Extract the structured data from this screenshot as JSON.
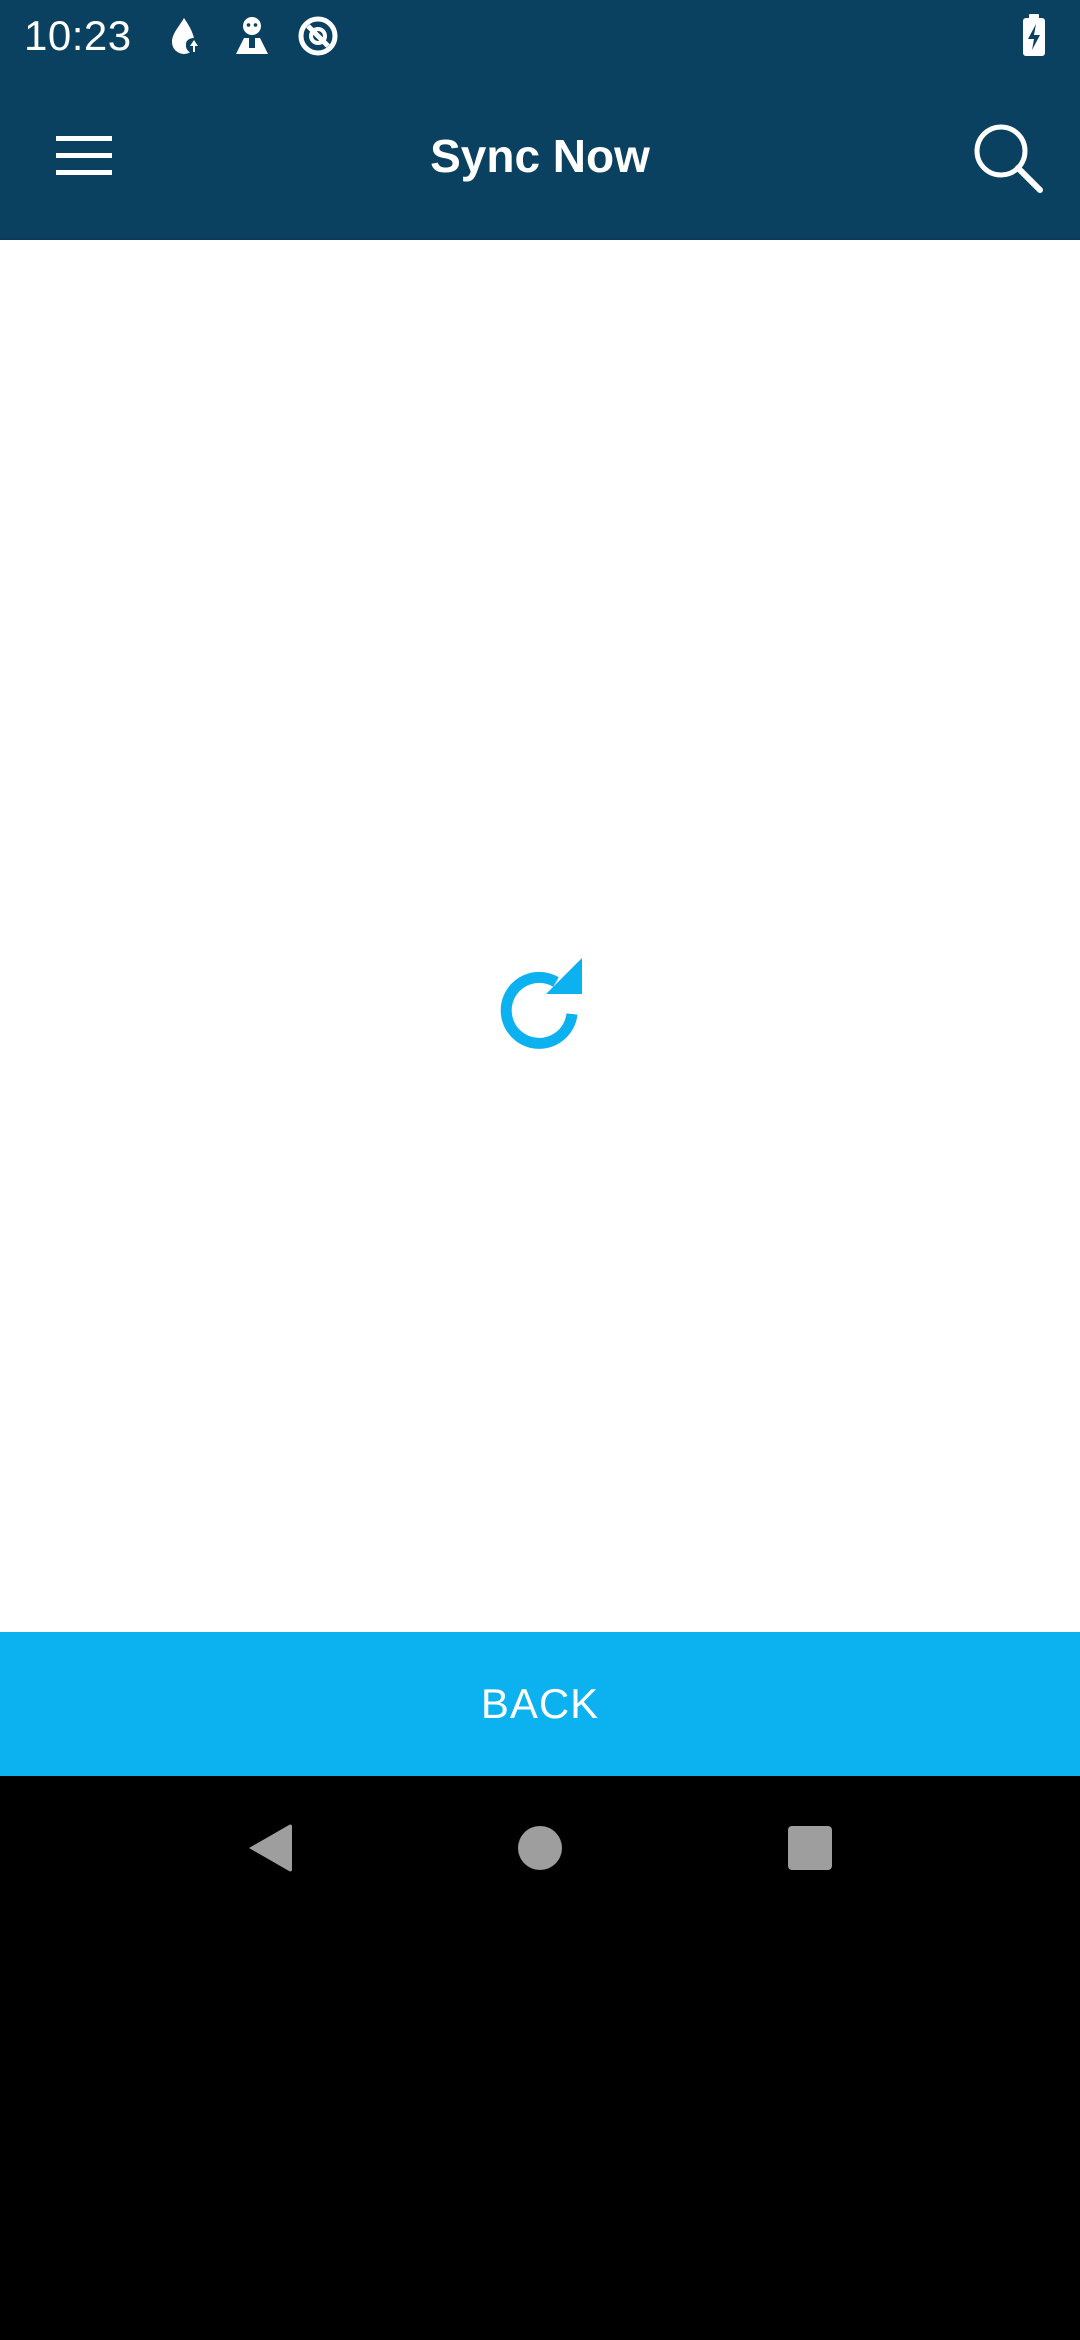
{
  "status_bar": {
    "time": "10:23",
    "icons": [
      "drop-notification-icon",
      "avatar-notification-icon",
      "no-disturb-icon"
    ],
    "battery_icon": "battery-charging-icon"
  },
  "app_bar": {
    "title": "Sync Now",
    "menu_icon": "hamburger-menu-icon",
    "search_icon": "search-icon",
    "background_color": "#0b4160"
  },
  "content": {
    "sync_icon": "refresh-icon",
    "accent_color": "#0cb1f0"
  },
  "footer": {
    "back_label": "BACK",
    "background_color": "#0cb1f0"
  },
  "nav_bar": {
    "back": "nav-back-icon",
    "home": "nav-home-icon",
    "recents": "nav-recents-icon"
  }
}
